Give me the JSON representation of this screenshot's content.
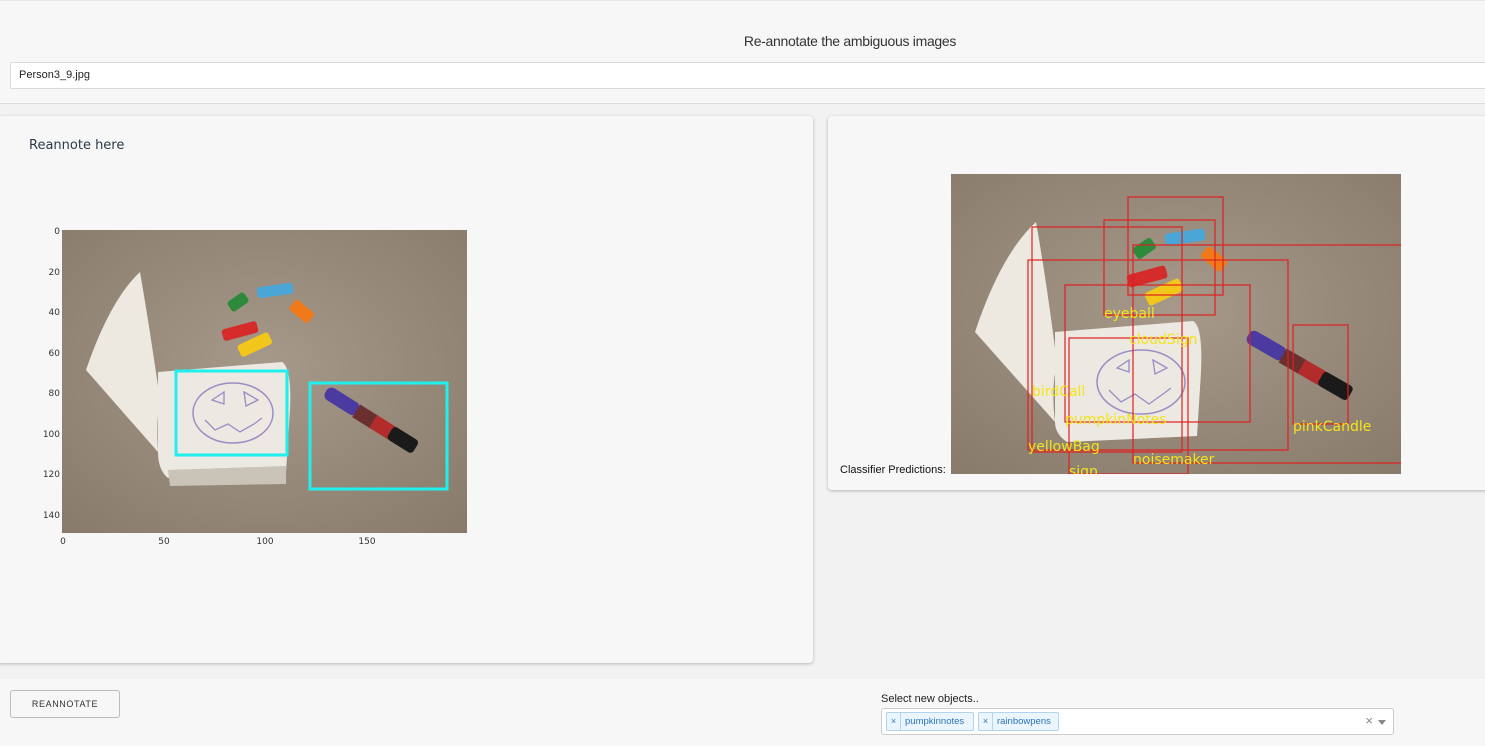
{
  "header": {
    "title": "Re-annotate the ambiguous images",
    "filename": "Person3_9.jpg"
  },
  "left_panel": {
    "heading": "Reannote here",
    "plot": {
      "y_ticks": [
        "0",
        "20",
        "40",
        "60",
        "80",
        "100",
        "120",
        "140"
      ],
      "x_ticks": [
        "0",
        "50",
        "100",
        "150"
      ],
      "box_color": "#1ff0ee"
    }
  },
  "right_panel": {
    "predictions_label": "Classifier Predictions:",
    "box_color": "#e02020",
    "label_color": "#f5e31a",
    "prediction_labels": [
      "eyeball",
      "cloudSign",
      "birdCall",
      "pumpkinNotes",
      "yellowBag",
      "sign",
      "noisemaker",
      "pinkCandle"
    ]
  },
  "footer": {
    "reannotate_button": "REANNOTATE",
    "select_label": "Select new objects..",
    "selected_objects": [
      "pumpkinnotes",
      "rainbowpens"
    ],
    "tag_remove": "×",
    "clear_icon": "×"
  }
}
